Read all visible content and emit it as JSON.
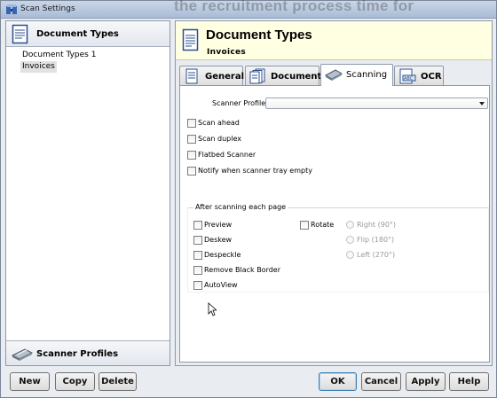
{
  "window": {
    "title": "Scan Settings",
    "background_ghost_text": "the recruitment process time for"
  },
  "left_panel": {
    "header_label": "Document Types",
    "tree_items": [
      {
        "label": "Document Types 1",
        "selected": false
      },
      {
        "label": "Invoices",
        "selected": true
      }
    ],
    "footer_label": "Scanner Profiles",
    "buttons": {
      "new": "New",
      "copy": "Copy",
      "delete": "Delete"
    }
  },
  "right_panel": {
    "header": {
      "title": "Document Types",
      "subtitle": "Invoices"
    },
    "tabs": [
      {
        "label": "General",
        "icon": "document-icon",
        "active": false
      },
      {
        "label": "Document",
        "icon": "documents-icon",
        "active": false
      },
      {
        "label": "Scanning",
        "icon": "scanner-icon",
        "active": true
      },
      {
        "label": "OCR",
        "icon": "ocr-icon",
        "active": false
      }
    ],
    "scanning": {
      "scanner_profile_label": "Scanner Profile:",
      "scanner_profile_value": "",
      "options": [
        {
          "label": "Scan ahead",
          "checked": false
        },
        {
          "label": "Scan duplex",
          "checked": false
        },
        {
          "label": "Flatbed Scanner",
          "checked": false
        },
        {
          "label": "Notify when scanner tray empty",
          "checked": false
        }
      ],
      "after_group": {
        "legend": "After scanning each page",
        "left_options": [
          {
            "label": "Preview",
            "checked": false
          },
          {
            "label": "Deskew",
            "checked": false
          },
          {
            "label": "Despeckle",
            "checked": false
          },
          {
            "label": "Remove Black Border",
            "checked": false
          },
          {
            "label": "AutoView",
            "checked": false
          }
        ],
        "rotate_label": "Rotate",
        "rotate_checked": false,
        "rotate_options": [
          {
            "label": "Right (90°)",
            "enabled": false
          },
          {
            "label": "Flip (180°)",
            "enabled": false
          },
          {
            "label": "Left (270°)",
            "enabled": false
          }
        ]
      }
    },
    "buttons": {
      "ok": "OK",
      "cancel": "Cancel",
      "apply": "Apply",
      "help": "Help"
    }
  },
  "colors": {
    "header_bg": "#ffffe1",
    "window_bg": "#e9ecf1",
    "focus_border": "#3c7fb1"
  }
}
